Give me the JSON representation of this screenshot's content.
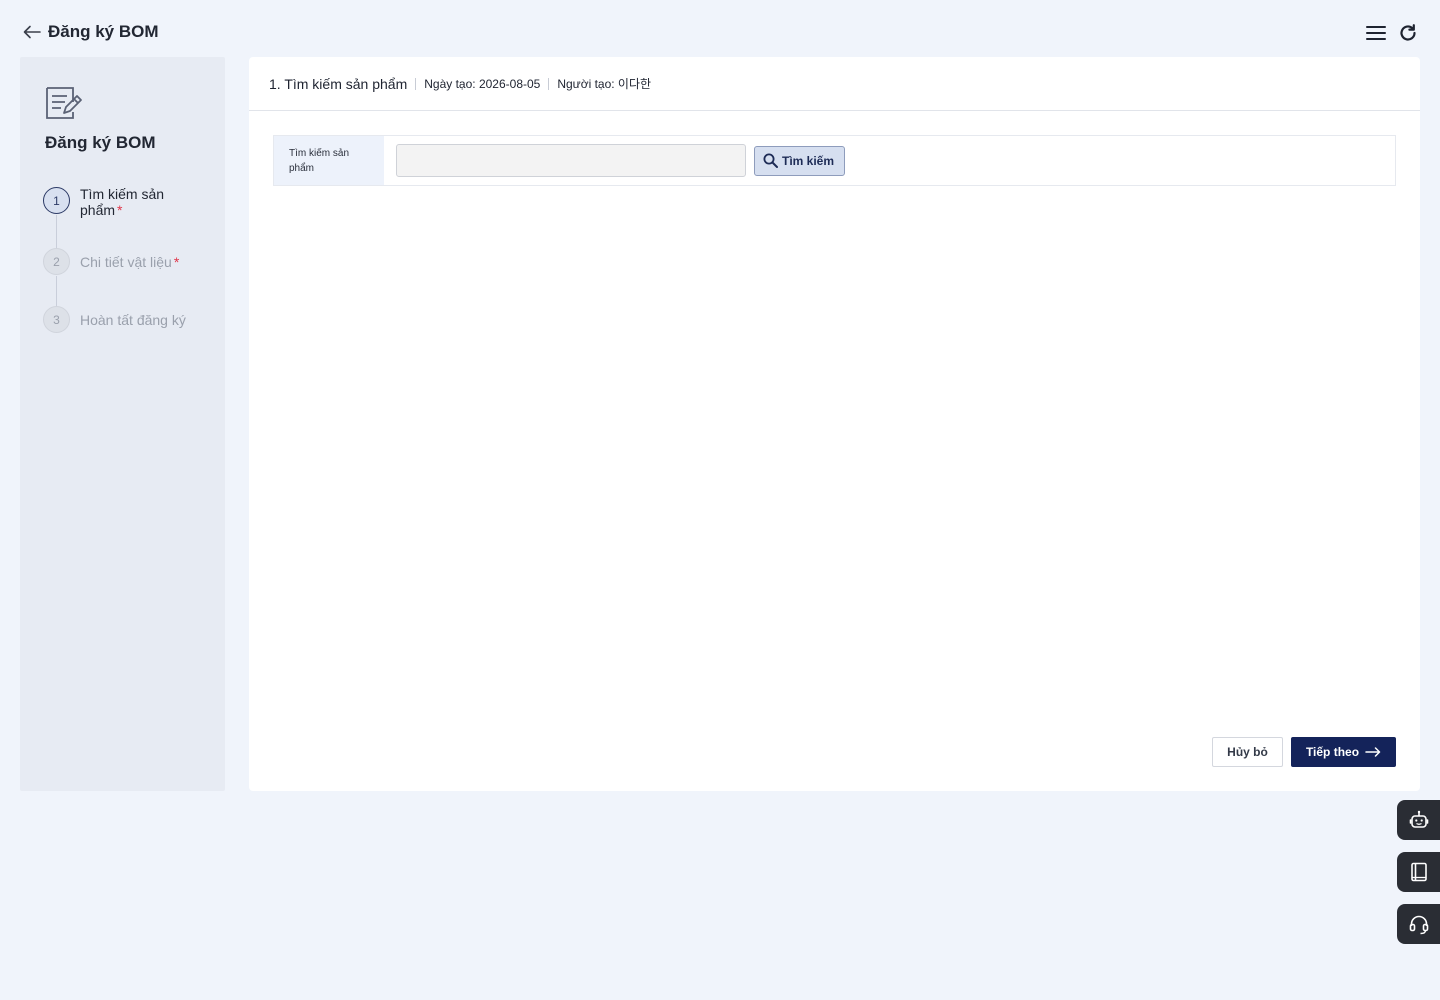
{
  "header": {
    "title": "Đăng ký BOM",
    "back_icon": "arrow-left-icon",
    "menu_icon": "hamburger-menu-icon",
    "refresh_icon": "refresh-icon"
  },
  "sidebar": {
    "icon": "document-edit-icon",
    "title": "Đăng ký BOM",
    "steps": [
      {
        "number": "1",
        "label": "Tìm kiếm sản phẩm",
        "required": "*",
        "state": "active"
      },
      {
        "number": "2",
        "label": "Chi tiết vật liệu",
        "required": "*",
        "state": "inactive"
      },
      {
        "number": "3",
        "label": "Hoàn tất đăng ký",
        "required": "",
        "state": "inactive"
      }
    ]
  },
  "main": {
    "step_title": "1. Tìm kiếm sản phẩm",
    "created_date": "Ngày tạo: 2026-08-05",
    "created_by": "Người tạo: 이다한",
    "search": {
      "label": "Tìm kiếm sản phẩm",
      "value": "",
      "placeholder": "",
      "button_label": "Tìm kiếm"
    },
    "footer": {
      "cancel_label": "Hủy bỏ",
      "next_label": "Tiếp theo"
    }
  },
  "floating_buttons": [
    {
      "icon": "chatbot-icon"
    },
    {
      "icon": "manual-book-icon"
    },
    {
      "icon": "headset-support-icon"
    }
  ],
  "colors": {
    "background": "#f0f4fb",
    "primary": "#14235a",
    "required": "#e0364a",
    "sidebar": "#e7ebf3"
  }
}
